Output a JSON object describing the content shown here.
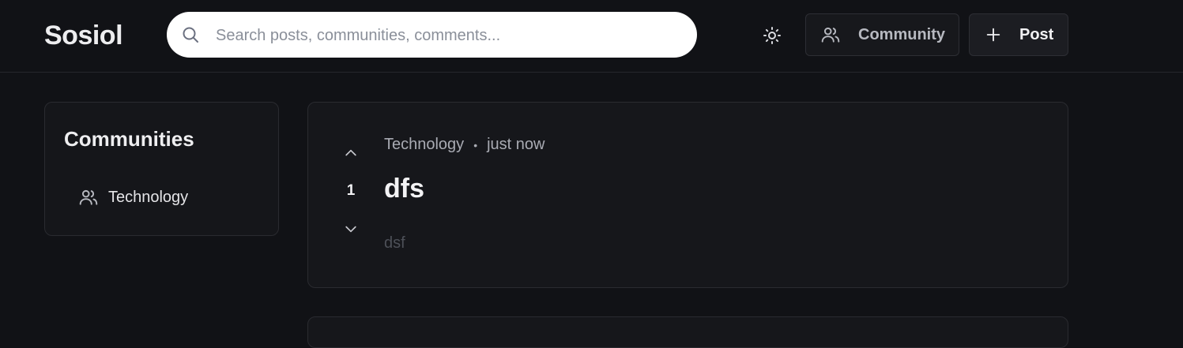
{
  "app": {
    "logo": "Sosiol"
  },
  "search": {
    "placeholder": "Search posts, communities, comments..."
  },
  "header": {
    "theme_icon": "sun-icon",
    "community_label": "Community",
    "community_icon": "users-icon",
    "post_label": "Post",
    "post_icon": "plus-icon"
  },
  "sidebar": {
    "title": "Communities",
    "items": [
      {
        "label": "Technology",
        "icon": "users-icon"
      }
    ]
  },
  "posts": [
    {
      "community": "Technology",
      "separator": "•",
      "time": "just now",
      "title": "dfs",
      "body": "dsf",
      "votes": "1"
    }
  ],
  "colors": {
    "background": "#111216",
    "card": "#16171b",
    "border": "#2a2b30",
    "text": "#e8e8ea",
    "muted": "#a9abb3"
  }
}
